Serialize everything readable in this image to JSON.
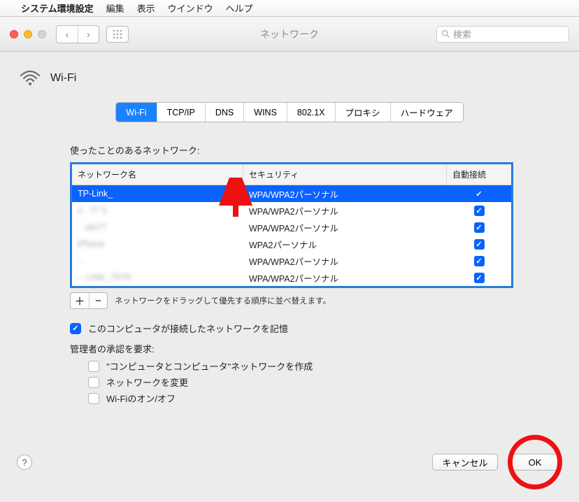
{
  "menubar": {
    "app": "システム環境設定",
    "items": [
      "編集",
      "表示",
      "ウインドウ",
      "ヘルプ"
    ]
  },
  "window": {
    "title": "ネットワーク",
    "search_placeholder": "検索"
  },
  "heading": "Wi-Fi",
  "tabs": [
    "Wi-Fi",
    "TCP/IP",
    "DNS",
    "WINS",
    "802.1X",
    "プロキシ",
    "ハードウェア"
  ],
  "section_label": "使ったことのあるネットワーク:",
  "table": {
    "headers": [
      "ネットワーク名",
      "セキュリティ",
      "自動接続"
    ],
    "rows": [
      {
        "name": "TP-Link_",
        "security": "WPA/WPA2パーソナル",
        "auto": true,
        "selected": true,
        "hidden": false
      },
      {
        "name": "n  . 77 5",
        "security": "WPA/WPA2パーソナル",
        "auto": true,
        "selected": false,
        "hidden": true
      },
      {
        "name": "· .elo77",
        "security": "WPA/WPA2パーソナル",
        "auto": true,
        "selected": false,
        "hidden": true
      },
      {
        "name": "      iPhone",
        "security": "WPA2パーソナル",
        "auto": true,
        "selected": false,
        "hidden": true
      },
      {
        "name": "∴  ",
        "security": "WPA/WPA2パーソナル",
        "auto": true,
        "selected": false,
        "hidden": true
      },
      {
        "name": "-- LINK_7D70",
        "security": "WPA/WPA2パーソナル",
        "auto": true,
        "selected": false,
        "hidden": true
      }
    ]
  },
  "add_label": "＋",
  "remove_label": "−",
  "drag_hint": "ネットワークをドラッグして優先する順序に並べ替えます。",
  "remember_label": "このコンピュータが接続したネットワークを記憶",
  "admin_label": "管理者の承認を要求:",
  "admin_opts": [
    "\"コンピュータとコンピュータ\"ネットワークを作成",
    "ネットワークを変更",
    "Wi-Fiのオン/オフ"
  ],
  "cancel_label": "キャンセル",
  "ok_label": "OK"
}
